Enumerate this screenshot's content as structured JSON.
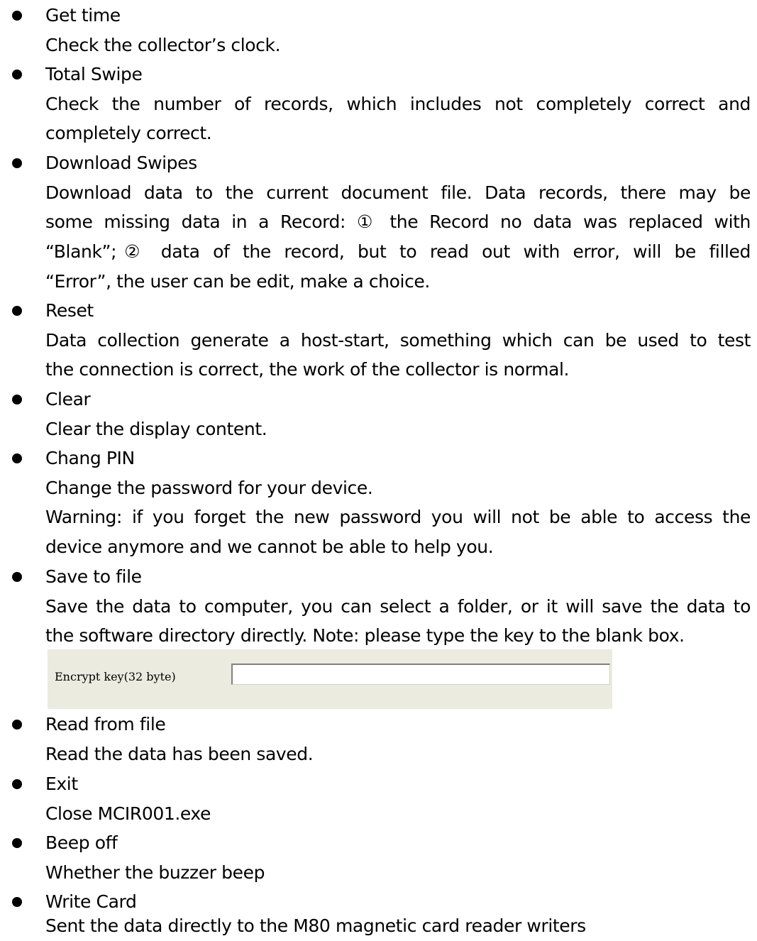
{
  "items": [
    {
      "title": "Get time",
      "desc": [
        "Check the collector’s clock."
      ]
    },
    {
      "title": "Total Swipe",
      "desc": [
        "Check the number of records, which includes not completely correct and",
        "completely correct."
      ]
    },
    {
      "title": "Download Swipes",
      "desc": [
        "Download data to the current document file. Data records, there may be",
        "some missing data in a Record: ① the Record no data was replaced with",
        "“Blank”;② data of the record, but to read out with error, will be filled",
        "“Error”, the user can be edit, make a choice."
      ]
    },
    {
      "title": "Reset",
      "desc": [
        "Data collection generate a host-start, something which can be used to test",
        "the connection is correct, the work of the collector is normal."
      ]
    },
    {
      "title": "Clear",
      "desc": [
        "Clear the display content."
      ]
    },
    {
      "title": "Chang PIN",
      "desc": [
        "Change the password for your device.",
        "Warning: if you forget the new password you will not be able to access the",
        "device anymore and we cannot be able to help you."
      ]
    },
    {
      "title": "Save to file",
      "desc": [
        "Save the data to computer, you can select a folder, or it will save the data to",
        "the software directory directly. Note: please type the key to the blank box."
      ]
    },
    {
      "title": "Read from file",
      "desc": [
        "Read the data has been saved."
      ]
    },
    {
      "title": "Exit",
      "desc": [
        "Close MCIR001.exe"
      ]
    },
    {
      "title": "Beep off",
      "desc": [
        "Whether the buzzer beep"
      ]
    },
    {
      "title": "Write Card",
      "desc": [
        "Sent the data directly to the M80 magnetic card reader writers"
      ]
    }
  ],
  "encrypt_panel": {
    "label": "Encrypt key(32 byte)",
    "value": ""
  }
}
